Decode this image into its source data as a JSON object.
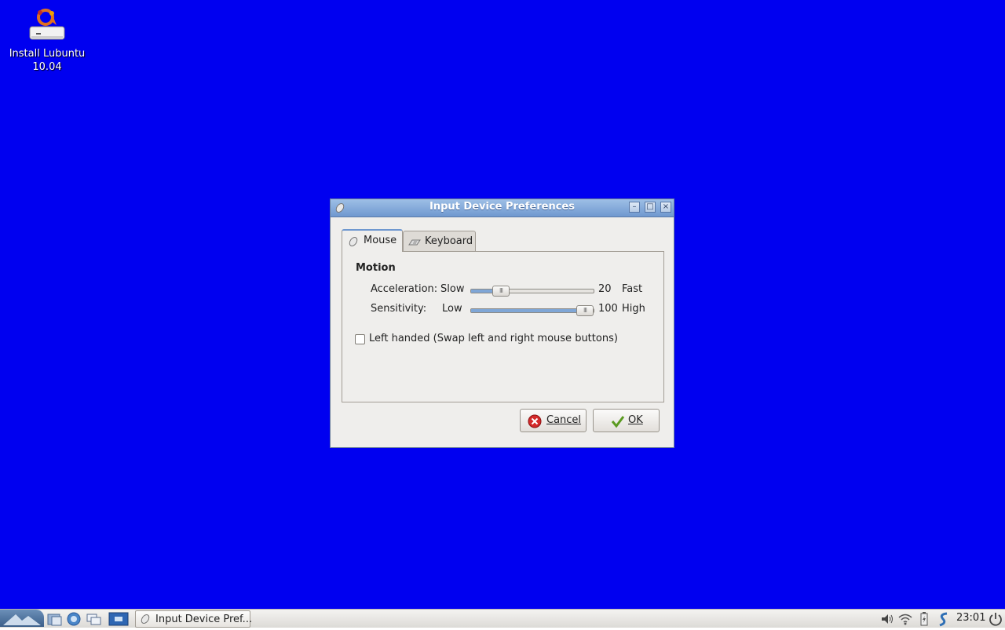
{
  "desktop": {
    "background_color": "#0000f0",
    "icon": {
      "name": "install-icon",
      "label_line1": "Install Lubuntu",
      "label_line2": "10.04"
    }
  },
  "window": {
    "title": "Input Device Preferences",
    "minimize_label": "–",
    "maximize_label": "□",
    "close_label": "×",
    "tabs": [
      {
        "label": "Mouse",
        "icon": "mouse-icon",
        "active": true
      },
      {
        "label": "Keyboard",
        "icon": "keyboard-icon",
        "active": false
      }
    ],
    "motion": {
      "title": "Motion",
      "acceleration": {
        "label": "Acceleration:",
        "min_label": "Slow",
        "max_label": "Fast",
        "value": "20",
        "fraction": 0.2
      },
      "sensitivity": {
        "label": "Sensitivity:",
        "min_label": "Low",
        "max_label": "High",
        "value": "100",
        "fraction": 1.0
      }
    },
    "left_handed": {
      "label": "Left handed (Swap left and right mouse buttons)",
      "checked": false
    },
    "buttons": {
      "cancel": "Cancel",
      "ok": "OK"
    }
  },
  "taskbar": {
    "task_label": "Input Device Pref...",
    "clock": "23:01"
  }
}
